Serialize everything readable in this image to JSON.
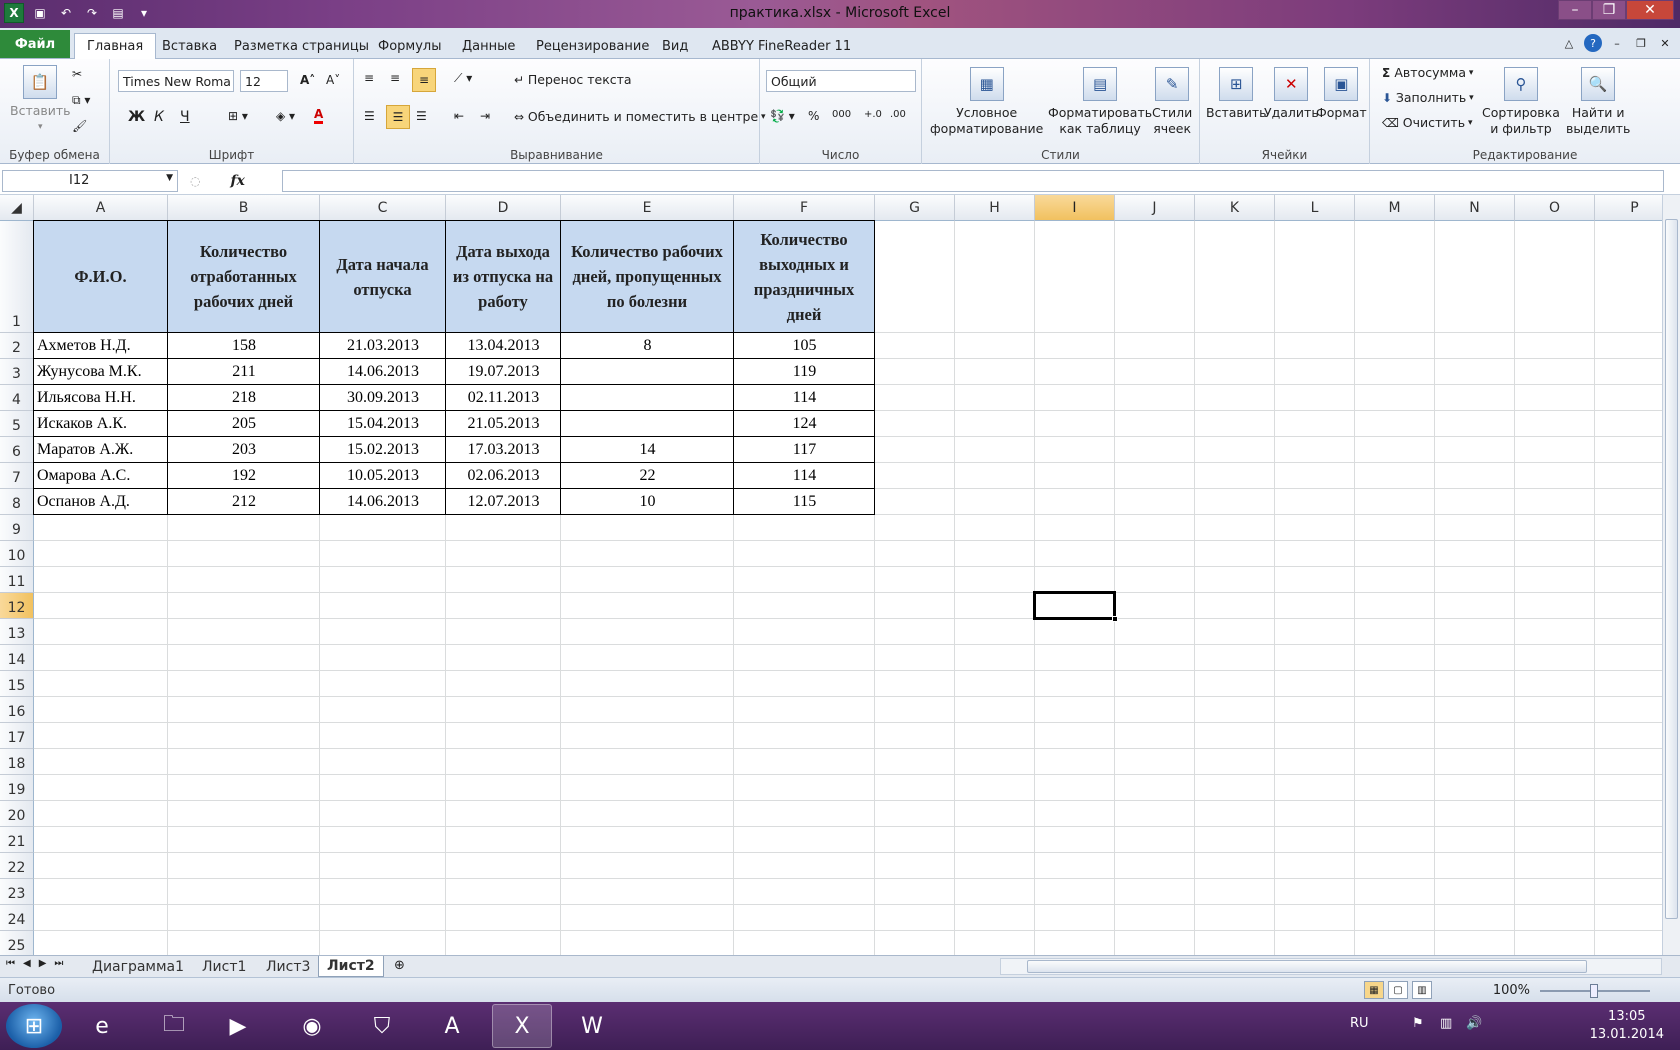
{
  "window": {
    "title": "практика.xlsx - Microsoft Excel"
  },
  "tabs": [
    "Файл",
    "Главная",
    "Вставка",
    "Разметка страницы",
    "Формулы",
    "Данные",
    "Рецензирование",
    "Вид",
    "ABBYY FineReader 11"
  ],
  "ribbon": {
    "clipboard": {
      "group": "Буфер обмена",
      "paste": "Вставить"
    },
    "font": {
      "group": "Шрифт",
      "family": "Times New Roma",
      "size": "12",
      "bold": "Ж",
      "italic": "К",
      "underline": "Ч"
    },
    "alignment": {
      "group": "Выравнивание",
      "wrap": "Перенос текста",
      "merge": "Объединить и поместить в центре"
    },
    "number": {
      "group": "Число",
      "format": "Общий",
      "percent": "%",
      "thousands": "000"
    },
    "styles": {
      "group": "Стили",
      "cond1": "Условное",
      "cond2": "форматирование",
      "table1": "Форматировать",
      "table2": "как таблицу",
      "cell1": "Стили",
      "cell2": "ячеек"
    },
    "cells": {
      "group": "Ячейки",
      "insert": "Вставить",
      "delete": "Удалить",
      "format": "Формат"
    },
    "editing": {
      "group": "Редактирование",
      "autosum": "Автосумма",
      "fill": "Заполнить",
      "clear": "Очистить",
      "sort1": "Сортировка",
      "sort2": "и фильтр",
      "find1": "Найти и",
      "find2": "выделить"
    }
  },
  "formula_bar": {
    "name_box": "I12",
    "fx": "fx",
    "formula": ""
  },
  "columns": [
    "A",
    "B",
    "C",
    "D",
    "E",
    "F",
    "G",
    "H",
    "I",
    "J",
    "K",
    "L",
    "M",
    "N",
    "O",
    "P"
  ],
  "selected": {
    "column": "I",
    "row": "12"
  },
  "rows": [
    "1",
    "2",
    "3",
    "4",
    "5",
    "6",
    "7",
    "8",
    "9",
    "10",
    "11",
    "12",
    "13",
    "14",
    "15",
    "16",
    "17",
    "18",
    "19",
    "20",
    "21",
    "22",
    "23",
    "24",
    "25"
  ],
  "sheet": {
    "headers": [
      "Ф.И.О.",
      "Количество отработанных рабочих дней",
      "Дата начала отпуска",
      "Дата выхода из отпуска на работу",
      "Количество рабочих дней, пропущенных по болезни",
      "Количество выходных и праздничных дней"
    ],
    "data": [
      [
        "Ахметов Н.Д.",
        "158",
        "21.03.2013",
        "13.04.2013",
        "8",
        "105"
      ],
      [
        "Жунусова М.К.",
        "211",
        "14.06.2013",
        "19.07.2013",
        "",
        "119"
      ],
      [
        "Ильясова Н.Н.",
        "218",
        "30.09.2013",
        "02.11.2013",
        "",
        "114"
      ],
      [
        "Искаков А.К.",
        "205",
        "15.04.2013",
        "21.05.2013",
        "",
        "124"
      ],
      [
        "Маратов А.Ж.",
        "203",
        "15.02.2013",
        "17.03.2013",
        "14",
        "117"
      ],
      [
        "Омарова А.С.",
        "192",
        "10.05.2013",
        "02.06.2013",
        "22",
        "114"
      ],
      [
        "Оспанов А.Д.",
        "212",
        "14.06.2013",
        "12.07.2013",
        "10",
        "115"
      ]
    ]
  },
  "sheet_tabs": [
    "Диаграмма1",
    "Лист1",
    "Лист3",
    "Лист2"
  ],
  "active_sheet": "Лист2",
  "status": {
    "ready": "Готово",
    "zoom": "100%"
  },
  "taskbar": {
    "lang": "RU",
    "time": "13:05",
    "date": "13.01.2014"
  }
}
